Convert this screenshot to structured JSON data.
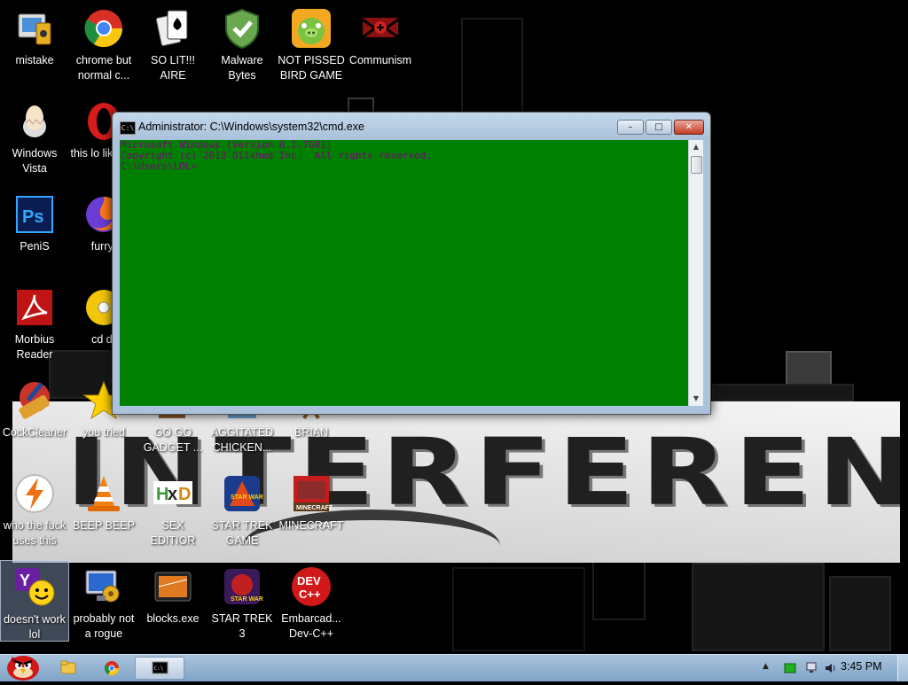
{
  "desktop_icons": [
    {
      "id": "mistake",
      "label": "mistake",
      "icon": "computer-sound-icon"
    },
    {
      "id": "chrome",
      "label": "chrome but normal c...",
      "icon": "chrome-icon"
    },
    {
      "id": "solit",
      "label": "SO LIT!!! AIRE",
      "icon": "solitaire-cards-icon"
    },
    {
      "id": "malware",
      "label": "Malware Bytes",
      "icon": "shield-check-icon"
    },
    {
      "id": "birdgame",
      "label": "NOT PISSED BIRD GAME",
      "icon": "green-pig-icon"
    },
    {
      "id": "communism",
      "label": "Communism",
      "icon": "red-emblem-icon"
    },
    {
      "id": "vista",
      "label": "Windows Vista",
      "icon": "egg-icon"
    },
    {
      "id": "opera",
      "label": "this lo like a v",
      "icon": "opera-icon"
    },
    {
      "id": "ps",
      "label": "PeniS",
      "icon": "photoshop-icon"
    },
    {
      "id": "firefox",
      "label": "furryf",
      "icon": "firefox-icon"
    },
    {
      "id": "morbius",
      "label": "Morbius Reader",
      "icon": "acrobat-icon"
    },
    {
      "id": "cddr",
      "label": "cd dr",
      "icon": "cd-icon"
    },
    {
      "id": "ccleaner",
      "label": "CockCleaner",
      "icon": "broom-icon"
    },
    {
      "id": "youtried",
      "label": "you tried",
      "icon": "star-icon"
    },
    {
      "id": "gogo",
      "label": "GO GO GADGET ...",
      "icon": "gadget-icon"
    },
    {
      "id": "chicken",
      "label": "AGGITATED CHICKEN...",
      "icon": "chicken-icon"
    },
    {
      "id": "brian",
      "label": "BRIAN",
      "icon": "brian-icon"
    },
    {
      "id": "whothe",
      "label": "who the fuck uses this",
      "icon": "lightning-icon"
    },
    {
      "id": "vlc",
      "label": "BEEP BEEP",
      "icon": "traffic-cone-icon"
    },
    {
      "id": "hxd",
      "label": "SEX EDITIOR",
      "icon": "hxd-icon"
    },
    {
      "id": "startrekgame",
      "label": "STAR TREK GAME",
      "icon": "star-wars-game-icon"
    },
    {
      "id": "minecraft",
      "label": "MINECRAFT",
      "icon": "minecraft-icon"
    },
    {
      "id": "yahoo",
      "label": "doesn't work lol",
      "icon": "yahoo-messenger-icon"
    },
    {
      "id": "rogue",
      "label": "probably not a rogue",
      "icon": "monitor-gears-icon"
    },
    {
      "id": "blocks",
      "label": "blocks.exe",
      "icon": "blocks-icon"
    },
    {
      "id": "startrek3",
      "label": "STAR TREK 3",
      "icon": "star-wars-3-icon"
    },
    {
      "id": "devcpp",
      "label": "Embarcad... Dev-C++",
      "icon": "devcpp-icon"
    }
  ],
  "banner": {
    "text": "INTERFERENCE"
  },
  "cmd_window": {
    "title": "Administrator: C:\\Windows\\system32\\cmd.exe",
    "icon": "console-icon",
    "buttons": {
      "minimize": "–",
      "maximize": "□",
      "close": "✕"
    },
    "lines": [
      "Microsoft Windows [Version 6.1.7601]",
      "Copyright (c) 2013 Oilshed Inc.  All rights reserved.",
      "C:\\Users\\LOL>"
    ],
    "console_bg": "#008000",
    "console_fg": "#800080"
  },
  "taskbar": {
    "start": "angry-bird-start-icon",
    "pinned": [
      {
        "id": "explorer",
        "icon": "folder-icon"
      },
      {
        "id": "chrome",
        "icon": "chrome-icon"
      },
      {
        "id": "cmd",
        "icon": "console-icon",
        "active": true
      }
    ],
    "tray": {
      "show_hidden": "▲",
      "clock": "3:45 PM"
    }
  }
}
